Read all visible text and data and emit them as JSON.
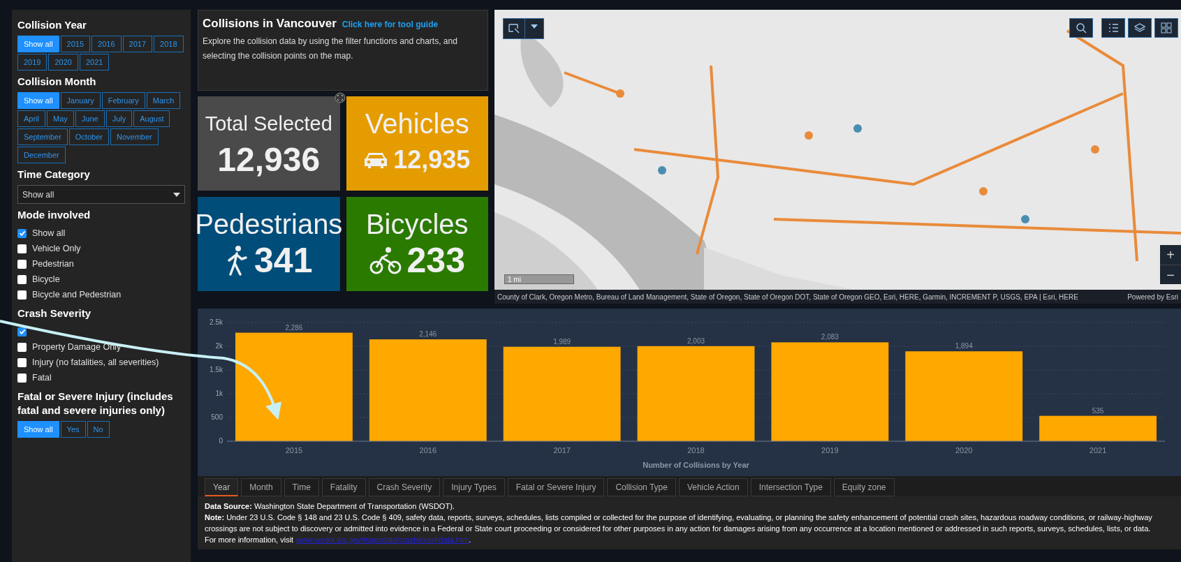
{
  "filters": {
    "collision_year": {
      "title": "Collision Year",
      "options": [
        {
          "label": "Show all",
          "selected": true
        },
        {
          "label": "2015",
          "selected": false
        },
        {
          "label": "2016",
          "selected": false
        },
        {
          "label": "2017",
          "selected": false
        },
        {
          "label": "2018",
          "selected": false
        },
        {
          "label": "2019",
          "selected": false
        },
        {
          "label": "2020",
          "selected": false
        },
        {
          "label": "2021",
          "selected": false
        }
      ]
    },
    "collision_month": {
      "title": "Collision Month",
      "options": [
        {
          "label": "Show all",
          "selected": true
        },
        {
          "label": "January",
          "selected": false
        },
        {
          "label": "February",
          "selected": false
        },
        {
          "label": "March",
          "selected": false
        },
        {
          "label": "April",
          "selected": false
        },
        {
          "label": "May",
          "selected": false
        },
        {
          "label": "June",
          "selected": false
        },
        {
          "label": "July",
          "selected": false
        },
        {
          "label": "August",
          "selected": false
        },
        {
          "label": "September",
          "selected": false
        },
        {
          "label": "October",
          "selected": false
        },
        {
          "label": "November",
          "selected": false
        },
        {
          "label": "December",
          "selected": false
        }
      ]
    },
    "time_category": {
      "title": "Time Category",
      "value": "Show all"
    },
    "mode_involved": {
      "title": "Mode involved",
      "options": [
        {
          "label": "Show all",
          "checked": true
        },
        {
          "label": "Vehicle Only",
          "checked": false
        },
        {
          "label": "Pedestrian",
          "checked": false
        },
        {
          "label": "Bicycle",
          "checked": false
        },
        {
          "label": "Bicycle and Pedestrian",
          "checked": false
        }
      ]
    },
    "crash_severity": {
      "title": "Crash Severity",
      "options": [
        {
          "checked": true
        },
        {
          "label": "Property Damage Only",
          "checked": false
        },
        {
          "label": "Injury (no fatalities, all severities)",
          "checked": false
        },
        {
          "label": "Fatal",
          "checked": false
        }
      ]
    },
    "fatal_or_severe": {
      "title": "Fatal or Severe Injury (includes fatal and severe injuries only)",
      "options": [
        {
          "label": "Show all",
          "selected": true
        },
        {
          "label": "Yes",
          "selected": false
        },
        {
          "label": "No",
          "selected": false
        }
      ]
    }
  },
  "header": {
    "title": "Collisions in Vancouver",
    "link": "Click here for tool guide",
    "description": "Explore the collision data  by using the filter functions and charts, and selecting the collision points on the map."
  },
  "cards": [
    {
      "kind": "total",
      "label": "Total Selected",
      "value": "12,936",
      "color": "#4a4a4a"
    },
    {
      "kind": "vehicle",
      "label": "Vehicles",
      "value": "12,935",
      "color": "#e59c00"
    },
    {
      "kind": "pedestrian",
      "label": "Pedestrians",
      "value": "341",
      "color": "#004d7a"
    },
    {
      "kind": "bicycle",
      "label": "Bicycles",
      "value": "233",
      "color": "#2a7a00"
    }
  ],
  "map": {
    "kind": "picture",
    "zoom_in": "+",
    "zoom_out": "−",
    "scale": "1 mi",
    "attribution": "County of Clark, Oregon Metro, Bureau of Land Management, State of Oregon, State of Oregon DOT, State of Oregon GEO, Esri, HERE, Garmin, INCREMENT P, USGS, EPA | Esri, HERE",
    "powered_by": "Powered by Esri"
  },
  "chart": {
    "chart_data": {
      "type": "bar",
      "xlabel": "Number of Collisions by Year",
      "categories": [
        "2015",
        "2016",
        "2017",
        "2018",
        "2019",
        "2020",
        "2021"
      ],
      "values": [
        2286,
        2146,
        1989,
        2003,
        2083,
        1894,
        535
      ],
      "value_labels": [
        "2,286",
        "2,146",
        "1,989",
        "2,003",
        "2,083",
        "1,894",
        "535"
      ],
      "ylim": [
        0,
        2500
      ],
      "yticks": [
        0,
        500,
        {
          "value": 1000,
          "label": "1k"
        },
        {
          "value": 1500,
          "label": "1.5k"
        },
        {
          "value": 2000,
          "label": "2k"
        },
        {
          "value": 2500,
          "label": "2.5k"
        }
      ],
      "data_labels": true,
      "grid": true
    }
  },
  "tabs": [
    {
      "label": "Year",
      "selected": true
    },
    {
      "label": "Month",
      "selected": false
    },
    {
      "label": "Time",
      "selected": false
    },
    {
      "label": "Fatality",
      "selected": false
    },
    {
      "label": "Crash Severity",
      "selected": false
    },
    {
      "label": "Injury Types",
      "selected": false
    },
    {
      "label": "Fatal or Severe Injury",
      "selected": false
    },
    {
      "label": "Collision Type",
      "selected": false
    },
    {
      "label": "Vehicle Action",
      "selected": false
    },
    {
      "label": "Intersection Type",
      "selected": false
    },
    {
      "label": "Equity zone",
      "selected": false
    }
  ],
  "footer": {
    "source": "**Data Source:** Washington State Department of Transportation (WSDOT).",
    "note": "**Note:** Under 23 U.S. Code § 148 and 23 U.S. Code § 409, safety data, reports, surveys, schedules, lists compiled or collected for the purpose of identifying, evaluating, or planning the safety enhancement of potential crash sites, hazardous roadway conditions, or railway-highway crossings are not subject to discovery or admitted into evidence in a Federal or State court proceeding or considered for other purposes in any action for damages arising from any occurrence at a location mentioned or addressed in such reports, surveys, schedules, lists, or data.",
    "more": "For more information, visit",
    "link": "www.wsdot.wa.gov/mapsdata/crash/crashdata.htm",
    "end": "."
  }
}
